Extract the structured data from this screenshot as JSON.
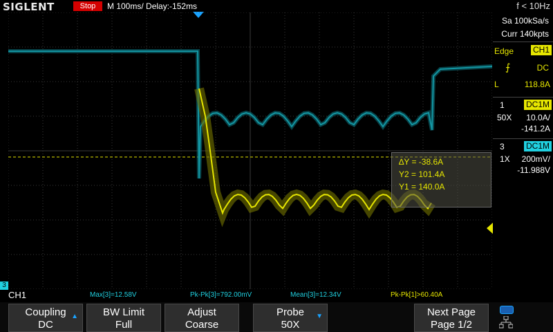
{
  "header": {
    "brand": "SIGLENT",
    "run_state": "Stop",
    "timebase": "M 100ms/",
    "delay": "Delay:-152ms",
    "trigger_freq": "f < 10Hz"
  },
  "acquisition": {
    "sample_rate": "Sa 100kSa/s",
    "memory_depth": "Curr 140kpts"
  },
  "trigger": {
    "type": "Edge",
    "source": "CH1",
    "coupling": "DC",
    "slope_icon": "rising-edge-icon",
    "level_label": "L",
    "level": "118.8A"
  },
  "channel1": {
    "number": "1",
    "coupling": "DC1M",
    "probe": "50X",
    "scale": "10.0A/",
    "offset": "-141.2A"
  },
  "channel3": {
    "number": "3",
    "coupling": "DC1M",
    "probe": "1X",
    "scale": "200mV/",
    "offset": "-11.988V"
  },
  "cursors": {
    "delta_y": "∆Y = -38.6A",
    "y2": "Y2 = 101.4A",
    "y1": "Y1 = 140.0A"
  },
  "measurements": {
    "active_channel": "CH1",
    "items": [
      "Max[3]=12.58V",
      "Pk-Pk[3]=792.00mV",
      "Mean[3]=12.34V",
      "Pk-Pk[1]>60.40A"
    ]
  },
  "softkeys": [
    {
      "line1": "Coupling",
      "line2": "DC",
      "arrow": "▲"
    },
    {
      "line1": "BW Limit",
      "line2": "Full",
      "arrow": ""
    },
    {
      "line1": "Adjust",
      "line2": "Coarse",
      "arrow": ""
    },
    {
      "line1": "Probe",
      "line2": "50X",
      "arrow": "▼"
    },
    {
      "line1": "Next Page",
      "line2": "Page 1/2",
      "arrow": ""
    }
  ],
  "colors": {
    "ch1": "#e6e600",
    "ch3": "#20d0e0",
    "run_state_bg": "#d40000",
    "grid": "#404040"
  },
  "icons": {
    "usb": "usb-icon",
    "network": "network-icon"
  }
}
